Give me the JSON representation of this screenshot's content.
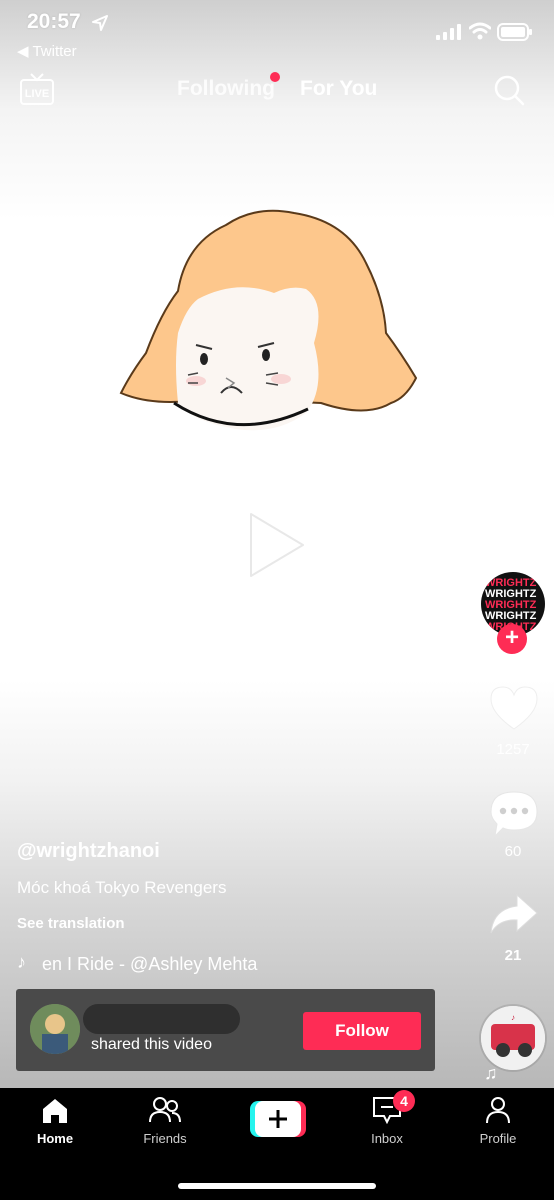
{
  "status_bar": {
    "time": "20:57",
    "back_app": "Twitter"
  },
  "top_nav": {
    "live_label": "LIVE",
    "tabs": [
      "Following",
      "For You"
    ],
    "active_tab": "For You"
  },
  "creator": {
    "avatar_lines": [
      "WRIGHTZ",
      "WRIGHTZ",
      "WRIGHTZ",
      "WRIGHTZ",
      "WRIGHTZ"
    ]
  },
  "actions": {
    "likes": "1257",
    "comments": "60",
    "shares": "21"
  },
  "post": {
    "username": "@wrightzhanoi",
    "caption": "Móc khoá Tokyo Revengers",
    "see_translation": "See translation",
    "song": "en I Ride - @Ashley Mehta"
  },
  "share_banner": {
    "shared_text": "shared this video",
    "follow_label": "Follow"
  },
  "bottom_nav": {
    "items": [
      "Home",
      "Friends",
      "Inbox",
      "Profile"
    ],
    "active": "Home",
    "inbox_badge": "4"
  },
  "colors": {
    "accent": "#fe2c55",
    "nav_bg": "#000000",
    "banner_bg": "#4a4a4a"
  },
  "icons": [
    "location-arrow-icon",
    "signal-icon",
    "wifi-icon",
    "battery-icon",
    "live-icon",
    "search-icon",
    "play-icon",
    "heart-icon",
    "comment-icon",
    "share-icon",
    "music-note-icon",
    "home-icon",
    "friends-icon",
    "plus-icon",
    "inbox-icon",
    "profile-icon"
  ]
}
